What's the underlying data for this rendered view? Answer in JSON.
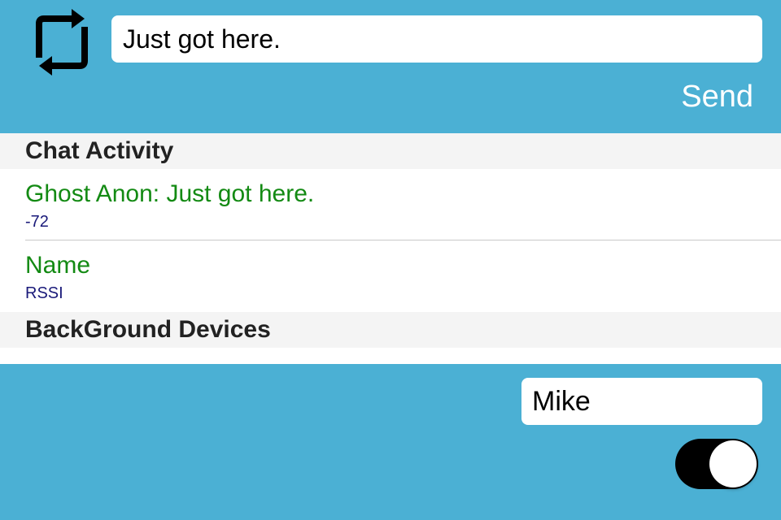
{
  "colors": {
    "background": "#4bb0d4",
    "cell_title": "#138a13",
    "cell_subtitle": "#1a1a7a",
    "section_header_bg": "#f4f4f4",
    "toggle_on": "#000000"
  },
  "header": {
    "refresh_icon": "refresh-icon",
    "message_value": "Just got here.",
    "send_label": "Send"
  },
  "sections": [
    {
      "title": "Chat Activity",
      "rows": [
        {
          "title": "Ghost Anon: Just got here.",
          "subtitle": "-72"
        },
        {
          "title": "Name",
          "subtitle": "RSSI"
        }
      ]
    },
    {
      "title": "BackGround Devices",
      "rows": []
    }
  ],
  "footer": {
    "name_value": "Mike",
    "toggle_on": true
  }
}
